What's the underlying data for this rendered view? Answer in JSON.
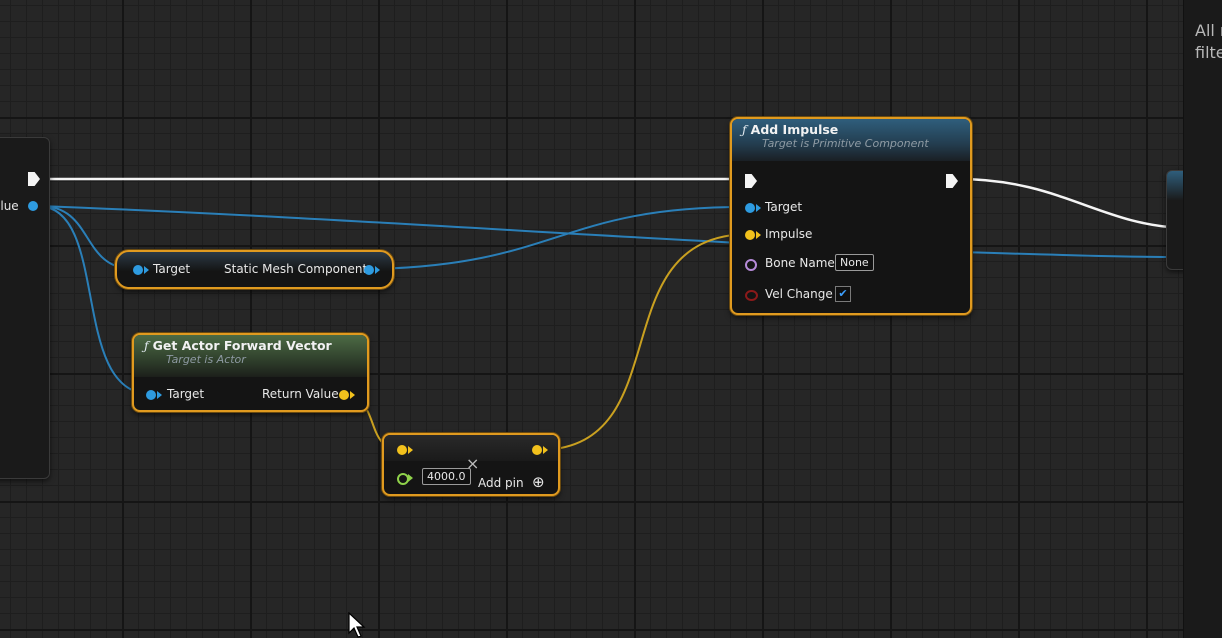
{
  "panel": {
    "message_line1": "All r",
    "message_line2": "filte"
  },
  "left_node": {
    "pin_label": "alue"
  },
  "mesh_node": {
    "target_label": "Target",
    "output_label": "Static Mesh Component"
  },
  "forward_node": {
    "title": "Get Actor Forward Vector",
    "subtitle": "Target is Actor",
    "target_label": "Target",
    "return_label": "Return Value"
  },
  "multiply_node": {
    "value": "4000.0",
    "add_pin_label": "Add pin"
  },
  "impulse_node": {
    "title": "Add Impulse",
    "subtitle": "Target is Primitive Component",
    "target_label": "Target",
    "impulse_label": "Impulse",
    "bone_name_label": "Bone Name",
    "bone_name_value": "None",
    "vel_change_label": "Vel Change",
    "vel_change_checked": "✔"
  },
  "icons": {
    "function": "ƒ",
    "add": "⊕",
    "remove": "×"
  },
  "colors": {
    "node_border": "#e09a1f",
    "object_pin": "#2e9be0",
    "vector_pin": "#f2c11c",
    "exec_wire": "#f4f4f4",
    "name_pin": "#b58ad8",
    "bool_pin": "#8c1a1a",
    "float_pin": "#8fd24a"
  }
}
